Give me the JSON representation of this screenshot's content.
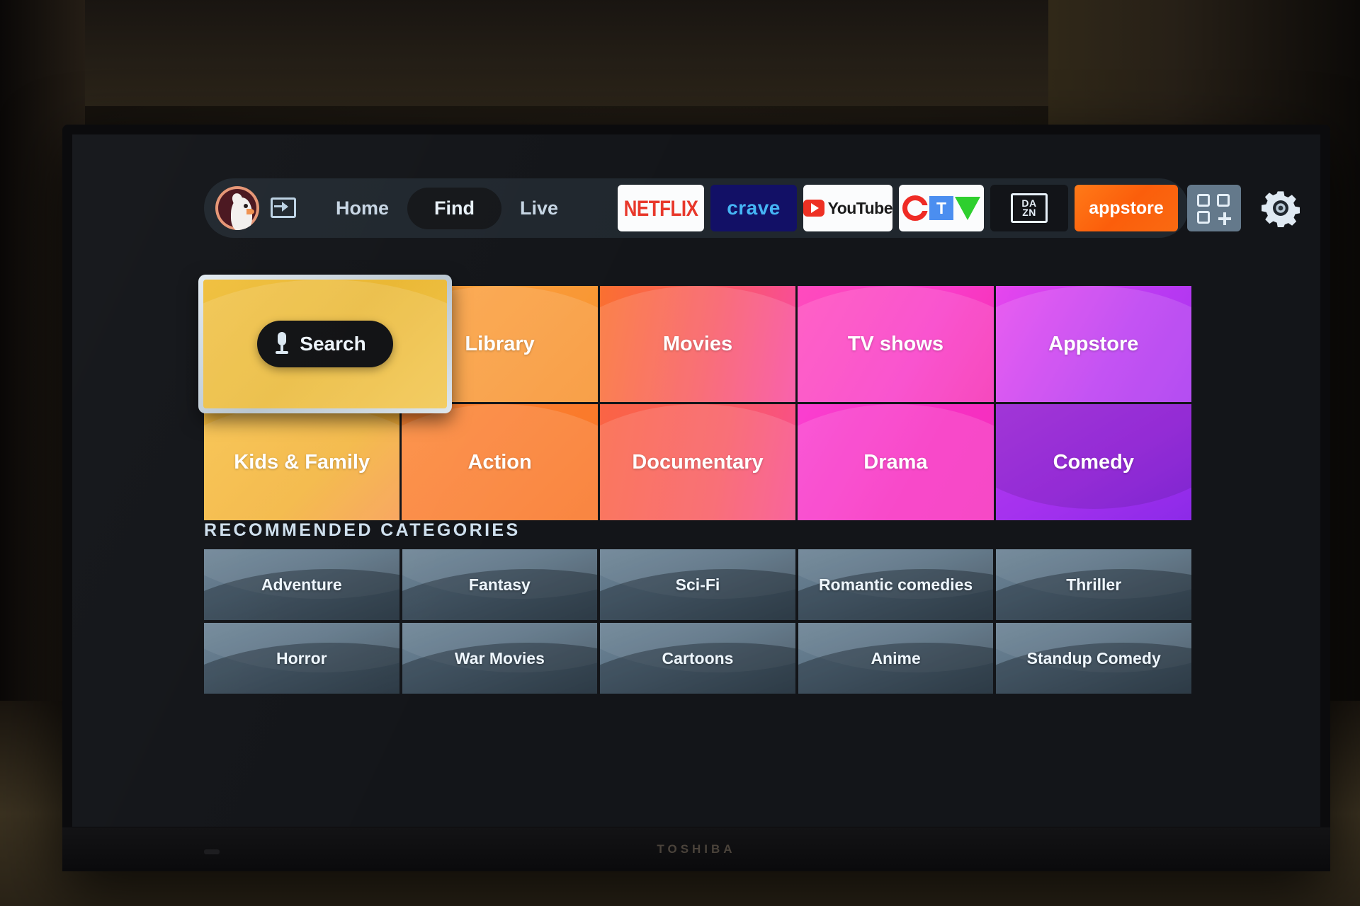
{
  "device": {
    "brand": "TOSHIBA"
  },
  "nav": {
    "avatar_name": "user-avatar",
    "input_icon": "input-source-icon",
    "links": [
      {
        "label": "Home",
        "active": false
      },
      {
        "label": "Find",
        "active": true
      },
      {
        "label": "Live",
        "active": false
      }
    ],
    "apps": [
      {
        "name": "netflix",
        "label": "NETFLIX"
      },
      {
        "name": "crave",
        "label": "crave"
      },
      {
        "name": "youtube",
        "label": "YouTube"
      },
      {
        "name": "ctv",
        "label": "CTV"
      },
      {
        "name": "dazn",
        "label_top": "DA",
        "label_bottom": "ZN"
      },
      {
        "name": "appstore",
        "label": "appstore"
      }
    ],
    "apps_grid_icon": "apps-grid-add-icon",
    "settings_icon": "gear-icon"
  },
  "search_tile": {
    "label": "Search",
    "mic_icon": "microphone-icon",
    "focused": true,
    "color": "#eab733"
  },
  "tiles": [
    {
      "label": "Library",
      "color": "#f79a36"
    },
    {
      "label": "Movies",
      "color": "#f9693f"
    },
    {
      "label": "TV shows",
      "color": "#f93fbe"
    },
    {
      "label": "Appstore",
      "color": "#c23af2"
    },
    {
      "label": "Kids & Family",
      "color": "#f5b43a"
    },
    {
      "label": "Action",
      "color": "#f97a2a"
    },
    {
      "label": "Documentary",
      "color": "#f95a5a"
    },
    {
      "label": "Drama",
      "color": "#f92fc8"
    },
    {
      "label": "Comedy",
      "color": "#a431ee"
    }
  ],
  "recommended": {
    "heading": "RECOMMENDED CATEGORIES",
    "items": [
      {
        "label": "Adventure"
      },
      {
        "label": "Fantasy"
      },
      {
        "label": "Sci-Fi"
      },
      {
        "label": "Romantic comedies"
      },
      {
        "label": "Thriller"
      },
      {
        "label": "Horror"
      },
      {
        "label": "War Movies"
      },
      {
        "label": "Cartoons"
      },
      {
        "label": "Anime"
      },
      {
        "label": "Standup Comedy"
      }
    ]
  }
}
